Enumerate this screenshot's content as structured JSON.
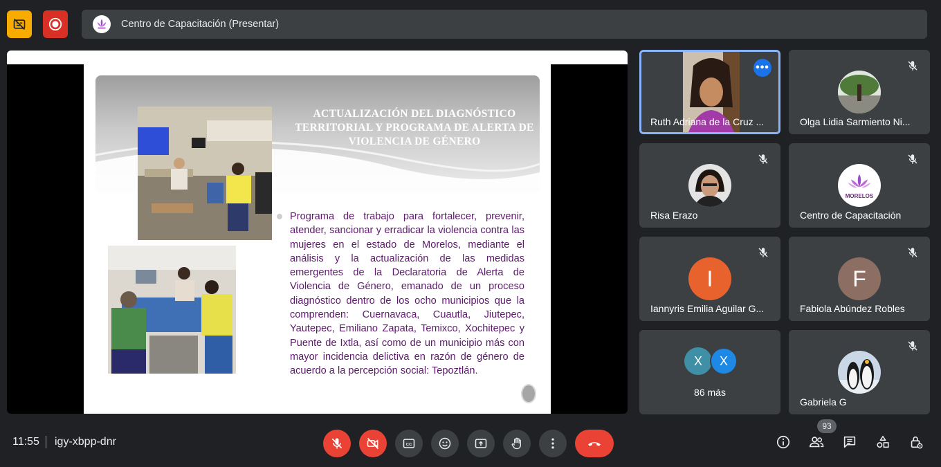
{
  "header": {
    "title": "Centro de Capacitación (Presentar)",
    "icons": [
      "no-captions-icon",
      "recording-icon"
    ]
  },
  "slide": {
    "title": "ACTUALIZACIÓN DEL DIAGNÓSTICO TERRITORIAL Y PROGRAMA DE ALERTA DE VIOLENCIA DE GÉNERO",
    "body": "Programa de trabajo para fortalecer, prevenir, atender, sancionar y erradicar la violencia contra las mujeres en el estado de Morelos, mediante el análisis y la actualización de las medidas emergentes de la Declaratoria de Alerta de Violencia de Género, emanado de un proceso diagnóstico dentro de los ocho municipios que la comprenden: Cuernavaca, Cuautla, Jiutepec, Yautepec, Emiliano Zapata, Temixco, Xochitepec y Puente de Ixtla, así como de un municipio más con mayor incidencia delictiva en razón de género de acuerdo a la percepción social: Tepoztlán."
  },
  "participants": [
    {
      "name": "Ruth Adriana de la Cruz ...",
      "type": "video",
      "active": true
    },
    {
      "name": "Olga Lidia Sarmiento Ni...",
      "type": "photo",
      "muted": true
    },
    {
      "name": "Risa Erazo",
      "type": "photo",
      "muted": true
    },
    {
      "name": "Centro de Capacitación",
      "type": "logo",
      "logo_text": "MORELOS",
      "muted": true
    },
    {
      "name": "Iannyris Emilia Aguilar G...",
      "initial": "I",
      "color": "#e8622e",
      "muted": true
    },
    {
      "name": "Fabiola Abúndez Robles",
      "initial": "F",
      "color": "#8d6e63",
      "muted": true
    },
    {
      "name": "Gabriela G",
      "type": "photo",
      "muted": true
    }
  ],
  "more_tile": {
    "label": "86 más",
    "avatars": [
      {
        "initial": "X",
        "color": "#3f8fa6"
      },
      {
        "initial": "X",
        "color": "#1e88e5"
      }
    ]
  },
  "footer": {
    "time": "11:55",
    "meeting_code": "igy-xbpp-dnr",
    "participant_count": "93",
    "controls": [
      "mic-off-icon",
      "camera-off-icon",
      "captions-icon",
      "emoji-icon",
      "present-icon",
      "raise-hand-icon",
      "more-options-icon",
      "hang-up-icon"
    ],
    "right_controls": [
      "info-icon",
      "people-icon",
      "chat-icon",
      "activities-icon",
      "host-controls-icon"
    ]
  },
  "colors": {
    "background": "#202124",
    "tile": "#3c4043",
    "danger": "#ea4335",
    "accent": "#8ab4f8",
    "slide_text": "#5c1a6b"
  }
}
